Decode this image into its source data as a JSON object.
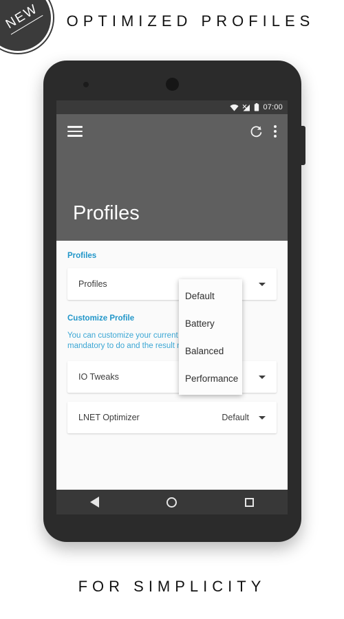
{
  "promo": {
    "badge_label": "NEW",
    "headline": "OPTIMIZED PROFILES",
    "footer": "FOR SIMPLICITY"
  },
  "colors": {
    "accent_blue": "#2196c9",
    "description_blue": "#3aa6d4",
    "appbar_gray": "#5f5f5f",
    "statusbar_gray": "#3a3a3a",
    "navbar_gray": "#383838",
    "screen_bg": "#fafafa",
    "phone_body": "#2b2b2b"
  },
  "phone": {
    "statusbar": {
      "clock": "07:00",
      "icons": [
        "wifi-icon",
        "signal-no-sim-icon",
        "battery-icon"
      ]
    },
    "appbar": {
      "title": "Profiles",
      "menu_icon": "hamburger-menu-icon",
      "refresh_icon": "refresh-icon",
      "overflow_icon": "overflow-menu-icon"
    },
    "content": {
      "profiles_section": {
        "header": "Profiles",
        "row": {
          "label": "Profiles",
          "value": "",
          "caret": "chevron-down-icon"
        }
      },
      "customize_section": {
        "header": "Customize Profile",
        "description_line1": "You can customize your current profile but it is not",
        "description_line2": "mandatory to do and the result may vary",
        "rows": [
          {
            "label": "IO Tweaks",
            "value": "",
            "caret": "chevron-down-icon"
          },
          {
            "label": "LNET Optimizer",
            "value": "Default",
            "caret": "chevron-down-icon"
          }
        ]
      },
      "dropdown": {
        "open": true,
        "options": [
          "Default",
          "Battery",
          "Balanced",
          "Performance"
        ]
      }
    },
    "navbar": {
      "back": "back-nav-icon",
      "home": "home-nav-icon",
      "recents": "recents-nav-icon"
    }
  }
}
